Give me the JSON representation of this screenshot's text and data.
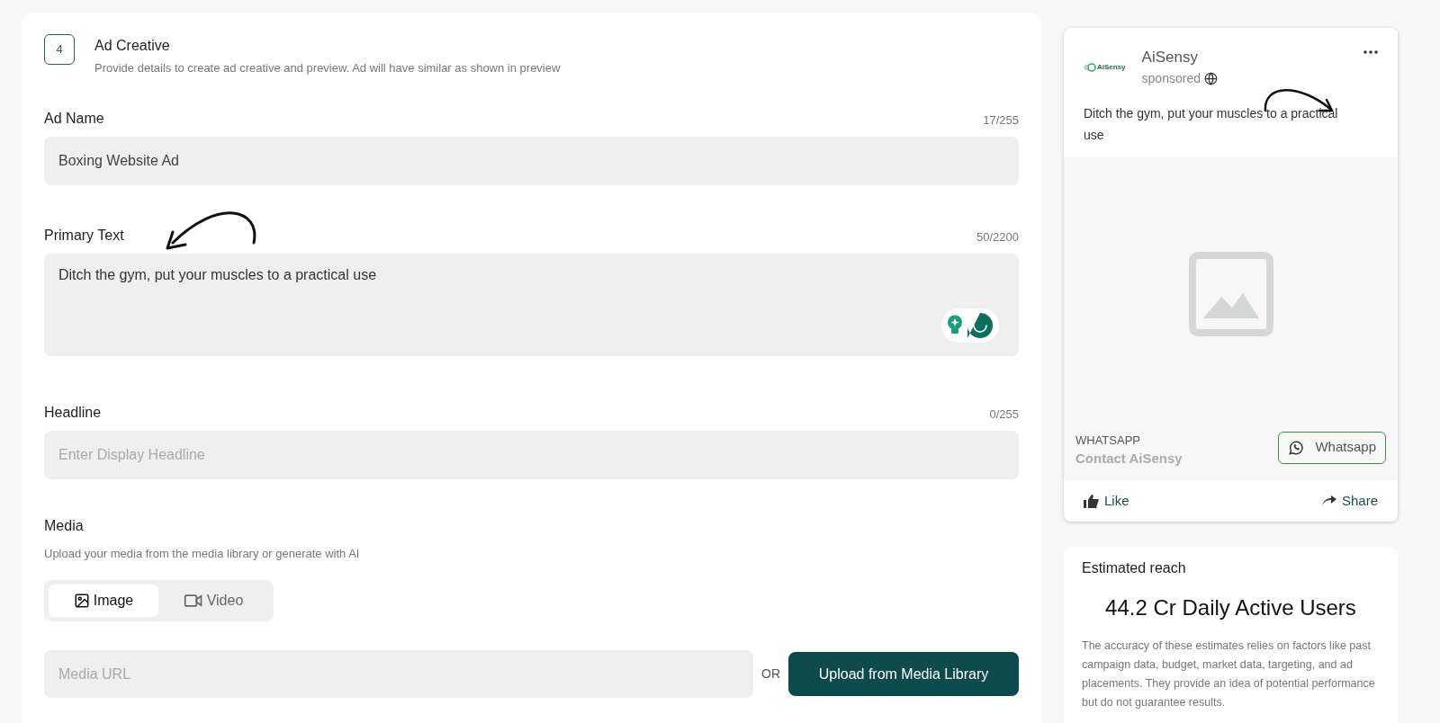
{
  "step": {
    "number": "4",
    "title": "Ad Creative",
    "subtitle": "Provide details to create ad creative and preview. Ad will have similar as shown in preview"
  },
  "fields": [
    {
      "kind": "input",
      "label": "Ad Name",
      "counter": "17/255",
      "value": "Boxing Website Ad"
    },
    {
      "kind": "textarea",
      "label": "Primary Text",
      "counter": "50/2200",
      "value": "Ditch the gym, put your muscles to a practical use"
    },
    {
      "kind": "input",
      "label": "Headline",
      "counter": "0/255",
      "placeholder": "Enter Display Headline"
    }
  ],
  "media": {
    "label": "Media",
    "hint": "Upload your media from the media library or generate with AI",
    "tabs": [
      {
        "label": "Image",
        "selected": true
      },
      {
        "label": "Video",
        "selected": false
      }
    ],
    "url_placeholder": "Media URL",
    "or": "OR",
    "upload_button": "Upload from Media Library"
  },
  "preview": {
    "logo_text": "AiSensy",
    "brand": "AiSensy",
    "sponsored": "sponsored",
    "post_text": "Ditch the gym, put your muscles to a practical use",
    "cta_kind": "WHATSAPP",
    "cta_title": "Contact AiSensy",
    "cta_button": "Whatsapp",
    "actions": [
      "Like",
      "Share"
    ]
  },
  "reach": {
    "title": "Estimated reach",
    "value": "44.2 Cr Daily Active Users",
    "note": "The accuracy of these estimates relies on factors like past campaign data, budget, market data, targeting, and ad placements. They provide an idea of potential performance but do not guarantee results."
  }
}
